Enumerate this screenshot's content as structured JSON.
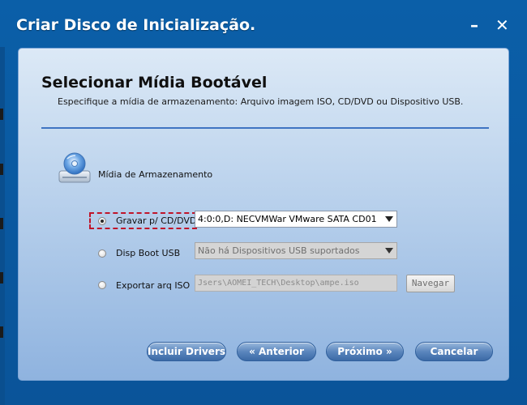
{
  "window": {
    "title": "Criar Disco de Inicialização."
  },
  "titlebar_buttons": {
    "minimize": "–",
    "close": "✕"
  },
  "heading": "Selecionar Mídia Bootável",
  "subtitle": "Especifique a mídia de armazenamento: Arquivo imagem ISO, CD/DVD ou Dispositivo USB.",
  "storage_label": "Mídia de Armazenamento",
  "options": [
    {
      "label": "Gravar p/ CD/DVD",
      "selected": true,
      "value": "4:0:0,D: NECVMWar VMware SATA CD01"
    },
    {
      "label": "Disp Boot USB",
      "selected": false,
      "value": "Não há Dispositivos USB suportados"
    },
    {
      "label": "Exportar arq ISO",
      "selected": false,
      "value": "Jsers\\AOMEI_TECH\\Desktop\\ampe.iso"
    }
  ],
  "browse_label": "Navegar",
  "buttons": {
    "drivers": "Incluir Drivers",
    "back": "Anterior",
    "back_icon": "«",
    "next": "Próximo",
    "next_icon": "»",
    "cancel": "Cancelar"
  },
  "icons": {
    "storage": "disc-icon"
  }
}
